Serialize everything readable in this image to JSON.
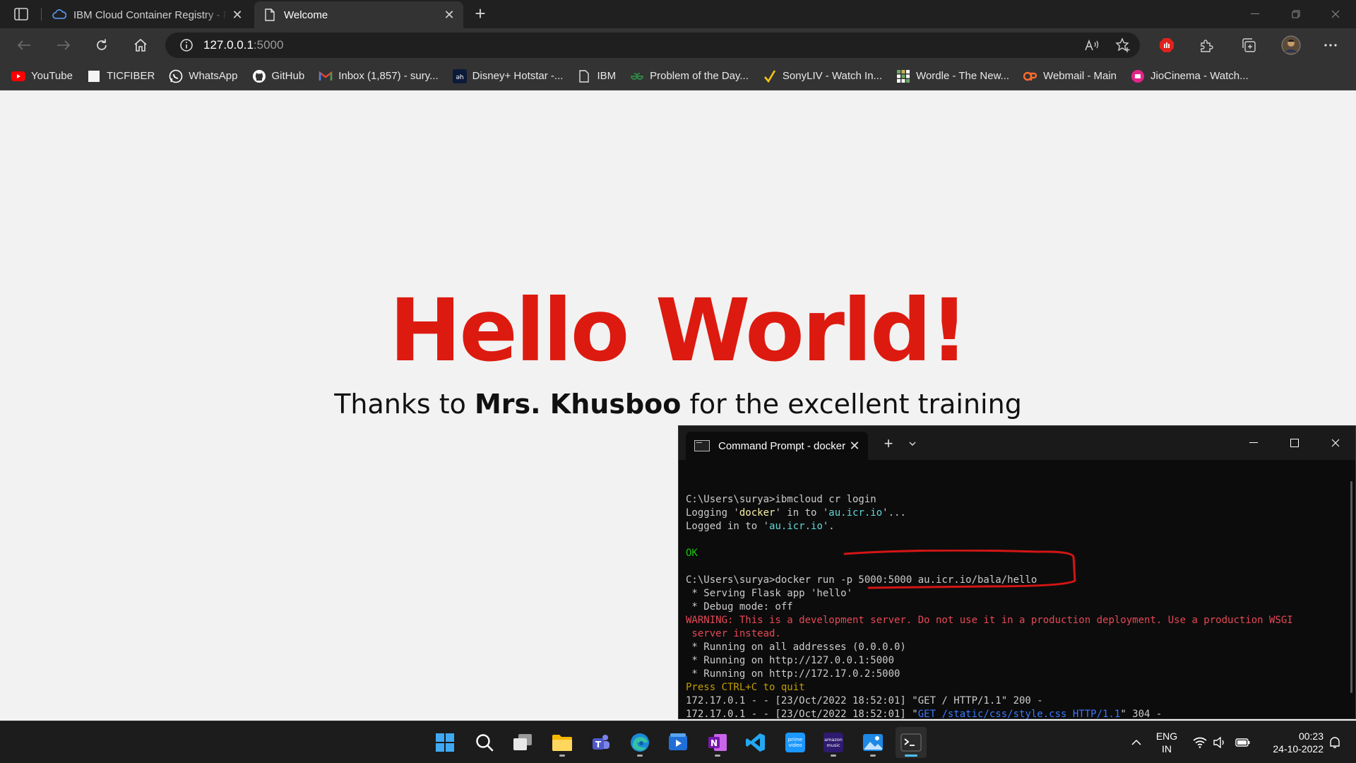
{
  "browser": {
    "tabs": [
      {
        "title": "IBM Cloud Container Registry - R",
        "active": false,
        "favicon": "ibm-cloud-icon"
      },
      {
        "title": "Welcome",
        "active": true,
        "favicon": "page-icon"
      }
    ],
    "address": {
      "host": "127.0.0.1",
      "port": ":5000"
    },
    "bookmarks": [
      {
        "label": "YouTube",
        "icon": "youtube-icon"
      },
      {
        "label": "TICFIBER",
        "icon": "page-icon"
      },
      {
        "label": "WhatsApp",
        "icon": "whatsapp-icon"
      },
      {
        "label": "GitHub",
        "icon": "github-icon"
      },
      {
        "label": "Inbox (1,857) - sury...",
        "icon": "gmail-icon"
      },
      {
        "label": "Disney+ Hotstar -...",
        "icon": "hotstar-icon"
      },
      {
        "label": "IBM",
        "icon": "page-icon"
      },
      {
        "label": "Problem of the Day...",
        "icon": "geeksforgeeks-icon"
      },
      {
        "label": "SonyLIV - Watch In...",
        "icon": "sonyliv-icon"
      },
      {
        "label": "Wordle - The New...",
        "icon": "wordle-icon"
      },
      {
        "label": "Webmail - Main",
        "icon": "cpanel-icon"
      },
      {
        "label": "JioCinema - Watch...",
        "icon": "jiocinema-icon"
      }
    ]
  },
  "page": {
    "heading": "Hello World!",
    "thanks_prefix": "Thanks to ",
    "thanks_name": "Mrs. Khusboo",
    "thanks_suffix": " for the excellent training"
  },
  "terminal": {
    "tab_title": "Command Prompt - docker r",
    "lines": [
      [
        {
          "t": ""
        }
      ],
      [
        {
          "t": "C:\\Users\\surya>ibmcloud cr login"
        }
      ],
      [
        {
          "t": "Logging '"
        },
        {
          "t": "docker",
          "c": "y"
        },
        {
          "t": "' in to '"
        },
        {
          "t": "au.icr.io",
          "c": "c"
        },
        {
          "t": "'..."
        }
      ],
      [
        {
          "t": "Logged in to '"
        },
        {
          "t": "au.icr.io",
          "c": "c"
        },
        {
          "t": "'."
        }
      ],
      [
        {
          "t": ""
        }
      ],
      [
        {
          "t": "OK",
          "c": "g"
        }
      ],
      [
        {
          "t": ""
        }
      ],
      [
        {
          "t": "C:\\Users\\surya>docker run -p 5000:5000 au.icr.io/bala/hello"
        }
      ],
      [
        {
          "t": " * Serving Flask app 'hello'"
        }
      ],
      [
        {
          "t": " * Debug mode: off"
        }
      ],
      [
        {
          "t": "WARNING: This is a development server. Do not use it in a production deployment. Use a production WSGI",
          "c": "r"
        }
      ],
      [
        {
          "t": " server instead.",
          "c": "r"
        }
      ],
      [
        {
          "t": " * Running on all addresses (0.0.0.0)"
        }
      ],
      [
        {
          "t": " * Running on http://127.0.0.1:5000"
        }
      ],
      [
        {
          "t": " * Running on http://172.17.0.2:5000"
        }
      ],
      [
        {
          "t": "Press CTRL+C to quit",
          "c": "o"
        }
      ],
      [
        {
          "t": "172.17.0.1 - - [23/Oct/2022 18:52:01] \"GET / HTTP/1.1\" 200 -"
        }
      ],
      [
        {
          "t": "172.17.0.1 - - [23/Oct/2022 18:52:01] \""
        },
        {
          "t": "GET /static/css/style.css HTTP/1.1",
          "c": "b"
        },
        {
          "t": "\" 304 -"
        }
      ]
    ]
  },
  "taskbar": {
    "apps": [
      {
        "name": "start-button",
        "active": false,
        "running": false
      },
      {
        "name": "search-button",
        "active": false,
        "running": false
      },
      {
        "name": "task-view-button",
        "active": false,
        "running": false
      },
      {
        "name": "file-explorer-app",
        "active": false,
        "running": true
      },
      {
        "name": "teams-app",
        "active": false,
        "running": false
      },
      {
        "name": "edge-app",
        "active": false,
        "running": true
      },
      {
        "name": "media-player-app",
        "active": false,
        "running": false
      },
      {
        "name": "onenote-app",
        "active": false,
        "running": true
      },
      {
        "name": "vscode-app",
        "active": false,
        "running": false
      },
      {
        "name": "prime-video-app",
        "active": false,
        "running": false
      },
      {
        "name": "amazon-music-app",
        "active": false,
        "running": true
      },
      {
        "name": "photos-app",
        "active": false,
        "running": true
      },
      {
        "name": "terminal-app",
        "active": true,
        "running": true
      }
    ],
    "lang_primary": "ENG",
    "lang_secondary": "IN",
    "time": "00:23",
    "date": "24-10-2022"
  }
}
